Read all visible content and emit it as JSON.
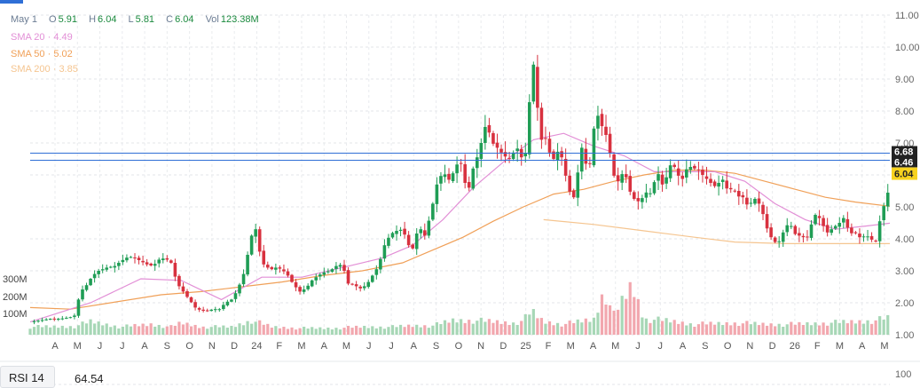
{
  "legend": {
    "date": "May 1",
    "open_label": "O",
    "open": "5.91",
    "high_label": "H",
    "high": "6.04",
    "low_label": "L",
    "low": "5.81",
    "close_label": "C",
    "close": "6.04",
    "vol_label": "Vol",
    "vol": "123.38M"
  },
  "indicators": [
    {
      "label": "SMA 20",
      "sep": "·",
      "value": "4.49",
      "color": "#e28fd6"
    },
    {
      "label": "SMA 50",
      "sep": "·",
      "value": "5.02",
      "color": "#f0a058"
    },
    {
      "label": "SMA 200",
      "sep": "·",
      "value": "3.85",
      "color": "#f5c590"
    }
  ],
  "rsi": {
    "label": "RSI 14",
    "value": "64.54"
  },
  "rsi_axis_label": "100",
  "colors": {
    "up": "#1f9d55",
    "down": "#d8313f",
    "vol_up": "#a7d7b6",
    "vol_down": "#f2a7ae",
    "price_line": "#2f6fd6",
    "price_tag": "#f7d21e",
    "marker_tag": "#222222"
  },
  "chart_data": {
    "type": "candlestick",
    "price_axis": {
      "min": 1.0,
      "max": 11.0,
      "scale": "linear",
      "ticks": [
        "11.00",
        "10.00",
        "9.00",
        "8.00",
        "7.00",
        "6.00",
        "5.00",
        "4.00",
        "3.00",
        "2.00",
        "1.00"
      ]
    },
    "volume_axis": {
      "ticks": [
        "300M",
        "200M",
        "100M"
      ]
    },
    "x_labels": [
      "A",
      "M",
      "J",
      "J",
      "A",
      "S",
      "O",
      "N",
      "D",
      "24",
      "F",
      "M",
      "A",
      "M",
      "J",
      "J",
      "A",
      "S",
      "O",
      "N",
      "D",
      "25",
      "F",
      "M",
      "A",
      "M",
      "J",
      "J",
      "A",
      "S",
      "O",
      "N",
      "D",
      "26",
      "F",
      "M",
      "A",
      "M"
    ],
    "grid": true,
    "price_lines": [
      {
        "value": 6.68,
        "label": "6.68"
      },
      {
        "value": 6.46,
        "label": "6.46"
      }
    ],
    "current_price": {
      "value": 6.04,
      "label": "6.04"
    },
    "close_path": [
      [
        0,
        1.4
      ],
      [
        10,
        1.45
      ],
      [
        20,
        1.5
      ],
      [
        30,
        1.5
      ],
      [
        40,
        1.55
      ],
      [
        44,
        1.6
      ],
      [
        50,
        2.35
      ],
      [
        56,
        2.55
      ],
      [
        62,
        2.85
      ],
      [
        68,
        3.0
      ],
      [
        76,
        3.1
      ],
      [
        84,
        3.15
      ],
      [
        90,
        3.3
      ],
      [
        98,
        3.45
      ],
      [
        104,
        3.4
      ],
      [
        110,
        3.3
      ],
      [
        116,
        3.2
      ],
      [
        122,
        3.15
      ],
      [
        128,
        3.35
      ],
      [
        134,
        3.4
      ],
      [
        140,
        3.25
      ],
      [
        146,
        2.6
      ],
      [
        152,
        2.35
      ],
      [
        158,
        2.1
      ],
      [
        164,
        1.85
      ],
      [
        170,
        1.75
      ],
      [
        176,
        1.75
      ],
      [
        182,
        1.8
      ],
      [
        188,
        1.8
      ],
      [
        194,
        2.0
      ],
      [
        200,
        2.1
      ],
      [
        206,
        2.4
      ],
      [
        212,
        2.9
      ],
      [
        216,
        3.5
      ],
      [
        220,
        4.1
      ],
      [
        224,
        4.3
      ],
      [
        228,
        3.6
      ],
      [
        232,
        3.2
      ],
      [
        236,
        3.1
      ],
      [
        240,
        3.05
      ],
      [
        244,
        3.1
      ],
      [
        250,
        3.05
      ],
      [
        256,
        2.85
      ],
      [
        262,
        2.55
      ],
      [
        268,
        2.35
      ],
      [
        274,
        2.45
      ],
      [
        280,
        2.7
      ],
      [
        286,
        2.85
      ],
      [
        292,
        2.95
      ],
      [
        298,
        3.0
      ],
      [
        304,
        3.15
      ],
      [
        310,
        3.2
      ],
      [
        316,
        2.6
      ],
      [
        322,
        2.55
      ],
      [
        328,
        2.45
      ],
      [
        334,
        2.55
      ],
      [
        340,
        2.85
      ],
      [
        346,
        3.15
      ],
      [
        352,
        3.8
      ],
      [
        358,
        4.15
      ],
      [
        364,
        4.25
      ],
      [
        370,
        4.3
      ],
      [
        376,
        3.8
      ],
      [
        380,
        3.7
      ],
      [
        386,
        4.4
      ],
      [
        392,
        4.1
      ],
      [
        398,
        4.8
      ],
      [
        404,
        5.7
      ],
      [
        410,
        6.1
      ],
      [
        416,
        5.85
      ],
      [
        422,
        6.15
      ],
      [
        426,
        6.5
      ],
      [
        430,
        6.2
      ],
      [
        434,
        5.3
      ],
      [
        438,
        5.9
      ],
      [
        442,
        6.5
      ],
      [
        446,
        6.6
      ],
      [
        450,
        7.4
      ],
      [
        454,
        7.6
      ],
      [
        458,
        7.05
      ],
      [
        462,
        6.9
      ],
      [
        466,
        6.8
      ],
      [
        470,
        6.6
      ],
      [
        474,
        6.55
      ],
      [
        478,
        6.45
      ],
      [
        482,
        6.95
      ],
      [
        486,
        6.7
      ],
      [
        490,
        6.4
      ],
      [
        494,
        6.95
      ],
      [
        498,
        9.6
      ],
      [
        502,
        9.3
      ],
      [
        506,
        6.9
      ],
      [
        510,
        7.3
      ],
      [
        514,
        7.0
      ],
      [
        518,
        6.4
      ],
      [
        522,
        6.6
      ],
      [
        526,
        6.85
      ],
      [
        530,
        6.25
      ],
      [
        534,
        5.7
      ],
      [
        538,
        5.25
      ],
      [
        542,
        5.35
      ],
      [
        546,
        6.8
      ],
      [
        550,
        6.9
      ],
      [
        554,
        5.8
      ],
      [
        558,
        6.9
      ],
      [
        562,
        8.0
      ],
      [
        566,
        7.7
      ],
      [
        570,
        7.35
      ],
      [
        574,
        7.15
      ],
      [
        578,
        6.2
      ],
      [
        582,
        5.75
      ],
      [
        586,
        5.85
      ],
      [
        590,
        6.2
      ],
      [
        594,
        5.65
      ],
      [
        598,
        5.3
      ],
      [
        602,
        5.2
      ],
      [
        606,
        5.15
      ],
      [
        610,
        5.4
      ],
      [
        614,
        5.5
      ],
      [
        618,
        5.35
      ],
      [
        622,
        6.2
      ],
      [
        626,
        5.85
      ],
      [
        630,
        5.55
      ],
      [
        634,
        6.3
      ],
      [
        638,
        6.3
      ],
      [
        642,
        6.2
      ],
      [
        646,
        5.75
      ],
      [
        650,
        6.0
      ],
      [
        654,
        6.35
      ],
      [
        658,
        6.15
      ],
      [
        662,
        6.25
      ],
      [
        666,
        6.05
      ],
      [
        670,
        5.95
      ],
      [
        674,
        5.8
      ],
      [
        678,
        5.7
      ],
      [
        682,
        5.6
      ],
      [
        686,
        5.9
      ],
      [
        690,
        5.8
      ],
      [
        694,
        5.35
      ],
      [
        698,
        5.75
      ],
      [
        702,
        5.25
      ],
      [
        706,
        5.4
      ],
      [
        710,
        5.2
      ],
      [
        714,
        4.95
      ],
      [
        718,
        5.3
      ],
      [
        722,
        5.2
      ],
      [
        726,
        5.0
      ],
      [
        730,
        4.55
      ],
      [
        734,
        4.1
      ],
      [
        738,
        4.0
      ],
      [
        742,
        3.8
      ],
      [
        746,
        4.05
      ],
      [
        750,
        4.35
      ],
      [
        754,
        4.5
      ],
      [
        758,
        4.3
      ],
      [
        762,
        4.0
      ],
      [
        766,
        4.2
      ],
      [
        770,
        3.9
      ],
      [
        774,
        4.2
      ],
      [
        778,
        4.7
      ],
      [
        782,
        4.8
      ],
      [
        786,
        4.5
      ],
      [
        790,
        4.3
      ],
      [
        794,
        4.1
      ],
      [
        798,
        4.5
      ],
      [
        802,
        4.3
      ],
      [
        806,
        4.7
      ],
      [
        810,
        4.6
      ],
      [
        814,
        4.1
      ],
      [
        818,
        4.25
      ],
      [
        822,
        4.1
      ],
      [
        826,
        4.0
      ],
      [
        830,
        4.15
      ],
      [
        834,
        4.0
      ],
      [
        838,
        3.95
      ],
      [
        842,
        3.9
      ],
      [
        846,
        5.2
      ],
      [
        850,
        4.85
      ],
      [
        854,
        6.04
      ]
    ],
    "close_path_x_unit": "index",
    "sma20": [
      [
        0,
        1.4
      ],
      [
        60,
        2.0
      ],
      [
        110,
        2.75
      ],
      [
        150,
        2.7
      ],
      [
        190,
        2.1
      ],
      [
        230,
        2.8
      ],
      [
        270,
        2.8
      ],
      [
        310,
        3.1
      ],
      [
        350,
        3.4
      ],
      [
        380,
        3.8
      ],
      [
        410,
        4.6
      ],
      [
        440,
        5.6
      ],
      [
        470,
        6.4
      ],
      [
        500,
        7.1
      ],
      [
        530,
        7.3
      ],
      [
        560,
        6.9
      ],
      [
        590,
        6.6
      ],
      [
        620,
        6.1
      ],
      [
        650,
        6.1
      ],
      [
        680,
        6.1
      ],
      [
        710,
        5.8
      ],
      [
        740,
        5.1
      ],
      [
        770,
        4.6
      ],
      [
        800,
        4.3
      ],
      [
        830,
        4.4
      ],
      [
        854,
        4.49
      ]
    ],
    "sma50": [
      [
        0,
        1.85
      ],
      [
        40,
        1.8
      ],
      [
        80,
        2.0
      ],
      [
        130,
        2.25
      ],
      [
        170,
        2.35
      ],
      [
        210,
        2.5
      ],
      [
        250,
        2.65
      ],
      [
        290,
        2.85
      ],
      [
        330,
        3.0
      ],
      [
        370,
        3.25
      ],
      [
        400,
        3.65
      ],
      [
        430,
        4.05
      ],
      [
        460,
        4.55
      ],
      [
        490,
        5.0
      ],
      [
        520,
        5.4
      ],
      [
        550,
        5.55
      ],
      [
        580,
        5.8
      ],
      [
        610,
        6.0
      ],
      [
        640,
        6.15
      ],
      [
        670,
        6.15
      ],
      [
        700,
        6.05
      ],
      [
        730,
        5.8
      ],
      [
        760,
        5.55
      ],
      [
        790,
        5.3
      ],
      [
        820,
        5.15
      ],
      [
        854,
        5.02
      ]
    ],
    "sma200": [
      [
        510,
        4.6
      ],
      [
        560,
        4.45
      ],
      [
        610,
        4.25
      ],
      [
        660,
        4.05
      ],
      [
        700,
        3.9
      ],
      [
        750,
        3.85
      ],
      [
        800,
        3.85
      ],
      [
        854,
        3.85
      ]
    ],
    "volume_profile": [
      [
        0,
        30
      ],
      [
        44,
        32
      ],
      [
        60,
        50
      ],
      [
        90,
        30
      ],
      [
        120,
        40
      ],
      [
        140,
        30
      ],
      [
        150,
        45
      ],
      [
        170,
        30
      ],
      [
        200,
        30
      ],
      [
        220,
        55
      ],
      [
        240,
        30
      ],
      [
        270,
        25
      ],
      [
        300,
        25
      ],
      [
        330,
        30
      ],
      [
        360,
        30
      ],
      [
        380,
        35
      ],
      [
        400,
        35
      ],
      [
        420,
        55
      ],
      [
        440,
        55
      ],
      [
        460,
        50
      ],
      [
        480,
        45
      ],
      [
        490,
        55
      ],
      [
        498,
        90
      ],
      [
        510,
        50
      ],
      [
        530,
        40
      ],
      [
        560,
        60
      ],
      [
        570,
        170
      ],
      [
        580,
        75
      ],
      [
        598,
        190
      ],
      [
        610,
        60
      ],
      [
        630,
        55
      ],
      [
        660,
        40
      ],
      [
        700,
        45
      ],
      [
        730,
        40
      ],
      [
        760,
        40
      ],
      [
        790,
        45
      ],
      [
        820,
        50
      ],
      [
        840,
        55
      ],
      [
        854,
        65
      ]
    ]
  }
}
